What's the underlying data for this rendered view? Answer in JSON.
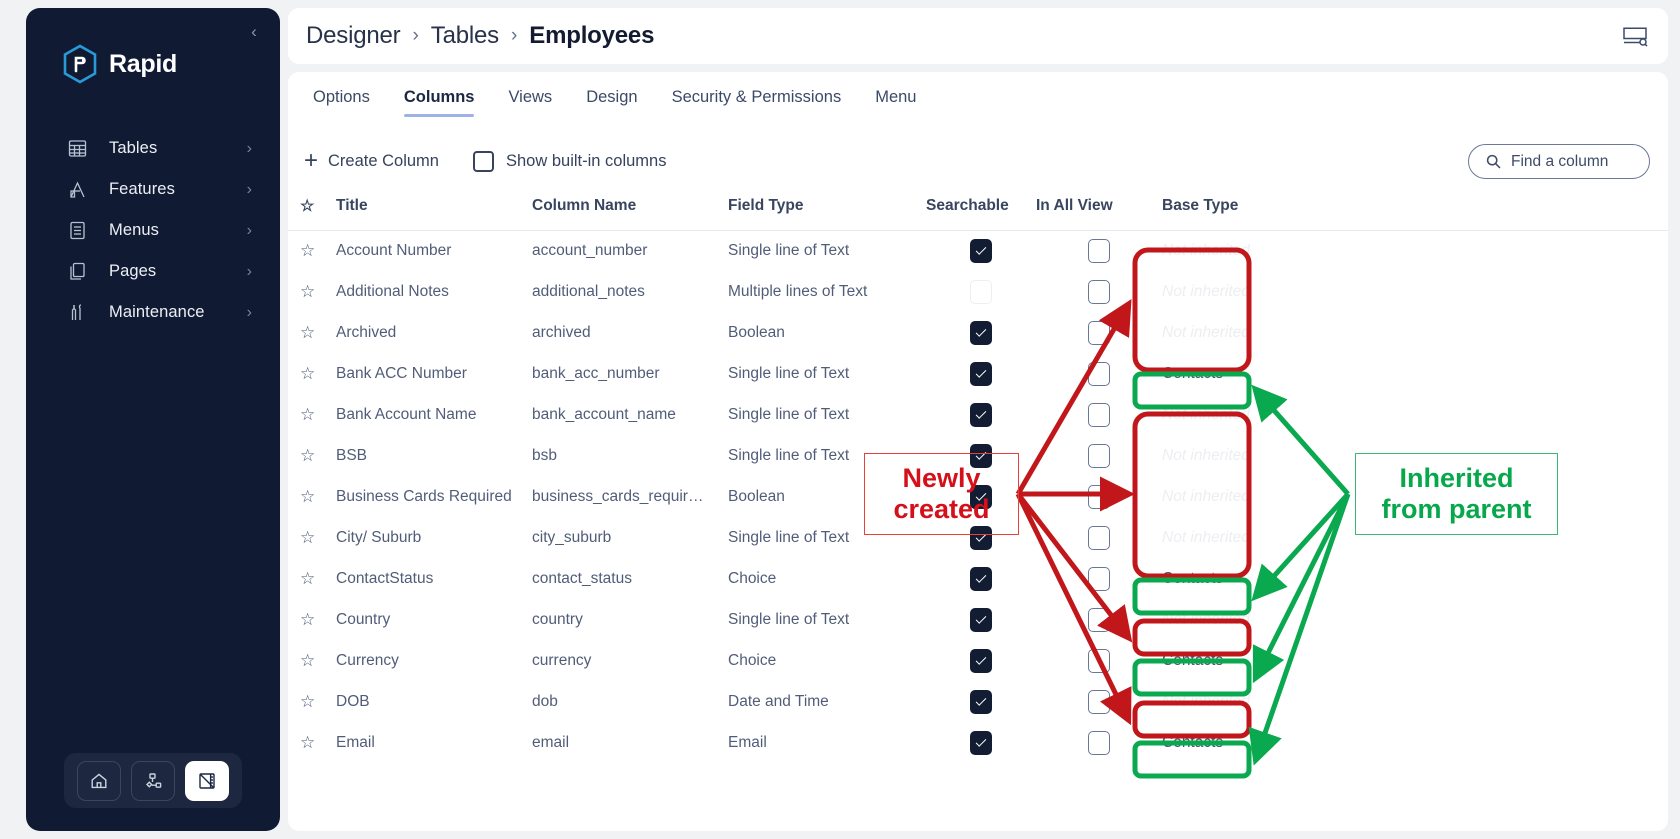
{
  "sidebar": {
    "brand": "Rapid",
    "collapse_icon": "chevron-left-icon",
    "items": [
      {
        "label": "Tables",
        "icon": "table-grid-icon",
        "chevron": "›"
      },
      {
        "label": "Features",
        "icon": "crane-icon",
        "chevron": "›"
      },
      {
        "label": "Menus",
        "icon": "list-document-icon",
        "chevron": "›"
      },
      {
        "label": "Pages",
        "icon": "pages-stack-icon",
        "chevron": "›"
      },
      {
        "label": "Maintenance",
        "icon": "tools-icon",
        "chevron": "›"
      }
    ],
    "dock": [
      {
        "icon": "home-icon",
        "active": false
      },
      {
        "icon": "sitemap-icon",
        "active": false
      },
      {
        "icon": "ruler-pencil-icon",
        "active": true
      }
    ]
  },
  "header": {
    "breadcrumb": [
      {
        "label": "Designer",
        "active": false
      },
      {
        "label": "Tables",
        "active": false
      },
      {
        "label": "Employees",
        "active": true
      }
    ],
    "separator": "›",
    "right_icon": "screen-search-icon"
  },
  "tabs": [
    {
      "label": "Options",
      "active": false
    },
    {
      "label": "Columns",
      "active": true
    },
    {
      "label": "Views",
      "active": false
    },
    {
      "label": "Design",
      "active": false
    },
    {
      "label": "Security & Permissions",
      "active": false
    },
    {
      "label": "Menu",
      "active": false
    }
  ],
  "toolbar": {
    "create_column_label": "Create Column",
    "create_column_icon": "plus-icon",
    "show_builtin_label": "Show built-in columns",
    "show_builtin_checked": false,
    "find_placeholder": "Find a column",
    "find_icon": "search-icon"
  },
  "table": {
    "headers": {
      "star": "☆",
      "title": "Title",
      "column_name": "Column Name",
      "field_type": "Field Type",
      "searchable": "Searchable",
      "in_all_view": "In All View",
      "base_type": "Base Type"
    },
    "not_inherited_text": "Not inherited",
    "rows": [
      {
        "title": "Account Number",
        "name": "account_number",
        "type": "Single line of Text",
        "searchable": "checked",
        "in_all_view": "unchecked",
        "base": "Not inherited",
        "inherited": false
      },
      {
        "title": "Additional Notes",
        "name": "additional_notes",
        "type": "Multiple lines of Text",
        "searchable": "unchecked",
        "in_all_view": "unchecked",
        "base": "Not inherited",
        "inherited": false
      },
      {
        "title": "Archived",
        "name": "archived",
        "type": "Boolean",
        "searchable": "checked",
        "in_all_view": "unchecked",
        "base": "Not inherited",
        "inherited": false
      },
      {
        "title": "Bank ACC Number",
        "name": "bank_acc_number",
        "type": "Single line of Text",
        "searchable": "checked",
        "in_all_view": "unchecked",
        "base": "Contacts",
        "inherited": true
      },
      {
        "title": "Bank Account Name",
        "name": "bank_account_name",
        "type": "Single line of Text",
        "searchable": "checked",
        "in_all_view": "unchecked",
        "base": "Not inherited",
        "inherited": false
      },
      {
        "title": "BSB",
        "name": "bsb",
        "type": "Single line of Text",
        "searchable": "checked",
        "in_all_view": "unchecked",
        "base": "Not inherited",
        "inherited": false
      },
      {
        "title": "Business Cards Required",
        "name": "business_cards_requir…",
        "type": "Boolean",
        "searchable": "checked",
        "in_all_view": "unchecked",
        "base": "Not inherited",
        "inherited": false
      },
      {
        "title": "City/ Suburb",
        "name": "city_suburb",
        "type": "Single line of Text",
        "searchable": "checked",
        "in_all_view": "unchecked",
        "base": "Not inherited",
        "inherited": false
      },
      {
        "title": "ContactStatus",
        "name": "contact_status",
        "type": "Choice",
        "searchable": "checked",
        "in_all_view": "unchecked",
        "base": "Contacts",
        "inherited": true
      },
      {
        "title": "Country",
        "name": "country",
        "type": "Single line of Text",
        "searchable": "checked",
        "in_all_view": "unchecked",
        "base": "Not inherited",
        "inherited": false
      },
      {
        "title": "Currency",
        "name": "currency",
        "type": "Choice",
        "searchable": "checked",
        "in_all_view": "unchecked",
        "base": "Contacts",
        "inherited": true
      },
      {
        "title": "DOB",
        "name": "dob",
        "type": "Date and Time",
        "searchable": "checked",
        "in_all_view": "unchecked",
        "base": "Not inherited",
        "inherited": false
      },
      {
        "title": "Email",
        "name": "email",
        "type": "Email",
        "searchable": "checked",
        "in_all_view": "unchecked",
        "base": "Contacts",
        "inherited": true
      }
    ]
  },
  "annotations": {
    "newly_created": {
      "line1": "Newly",
      "line2": "created",
      "color": "#d4101a"
    },
    "inherited_parent": {
      "line1": "Inherited",
      "line2": "from parent",
      "color": "#07a84c"
    }
  }
}
